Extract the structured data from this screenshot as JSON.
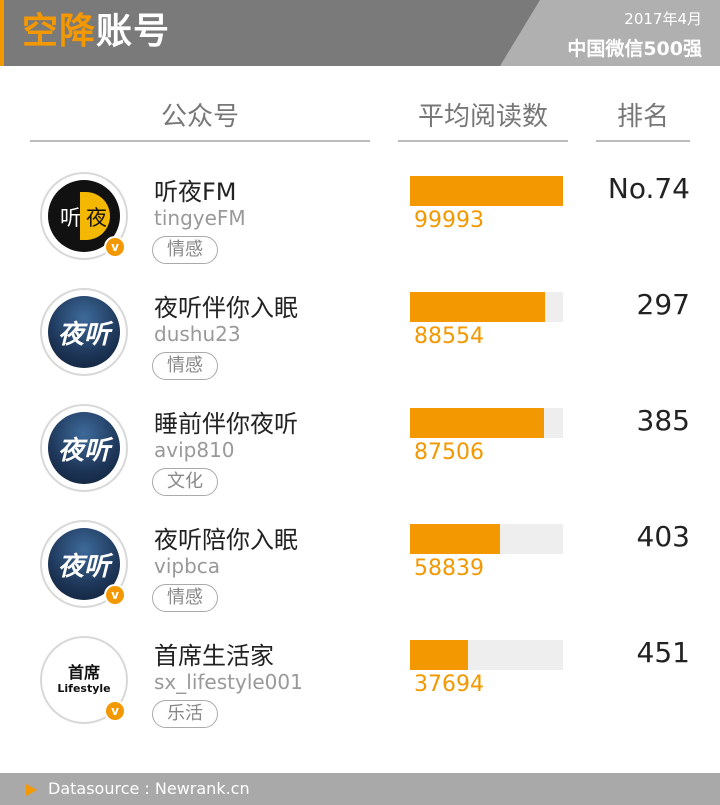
{
  "header": {
    "title_highlight": "空降",
    "title_rest": "账号",
    "date": "2017年4月",
    "subtitle": "中国微信500强"
  },
  "columns": {
    "account": "公众号",
    "reads": "平均阅读数",
    "rank": "排名"
  },
  "accounts": [
    {
      "name": "听夜FM",
      "id": "tingyeFM",
      "tag": "情感",
      "reads": "99993",
      "rank": "No.74",
      "avatar": "moon-logo",
      "verified": true
    },
    {
      "name": "夜听伴你入眠",
      "id": "dushu23",
      "tag": "情感",
      "reads": "88554",
      "rank": "297",
      "avatar": "night-sky-logo",
      "avatar_text": "夜听",
      "verified": false
    },
    {
      "name": "睡前伴你夜听",
      "id": "avip810",
      "tag": "文化",
      "reads": "87506",
      "rank": "385",
      "avatar": "night-sky-logo",
      "avatar_text": "夜听",
      "verified": false
    },
    {
      "name": "夜听陪你入眠",
      "id": "vipbca",
      "tag": "情感",
      "reads": "58839",
      "rank": "403",
      "avatar": "night-sky-logo",
      "avatar_text": "夜听",
      "verified": true
    },
    {
      "name": "首席生活家",
      "id": "sx_lifestyle001",
      "tag": "乐活",
      "reads": "37694",
      "rank": "451",
      "avatar": "lifestyle-logo",
      "avatar_text_1": "首席",
      "avatar_text_2": "Lifestyle",
      "verified": true
    }
  ],
  "avatar_text": {
    "moon_left": "听",
    "moon_right": "夜",
    "verified_mark": "v"
  },
  "chart_data": {
    "type": "bar",
    "categories": [
      "听夜FM",
      "夜听伴你入眠",
      "睡前伴你夜听",
      "夜听陪你入眠",
      "首席生活家"
    ],
    "values": [
      99993,
      88554,
      87506,
      58839,
      37694
    ],
    "ylim": [
      0,
      100000
    ],
    "orientation": "horizontal",
    "grid": false,
    "legend": "none"
  },
  "colors": {
    "accent": "#f39800",
    "header_bg": "#7a7a7a",
    "track": "#eeeeee"
  },
  "footer": {
    "source": "Datasource : Newrank.cn"
  }
}
